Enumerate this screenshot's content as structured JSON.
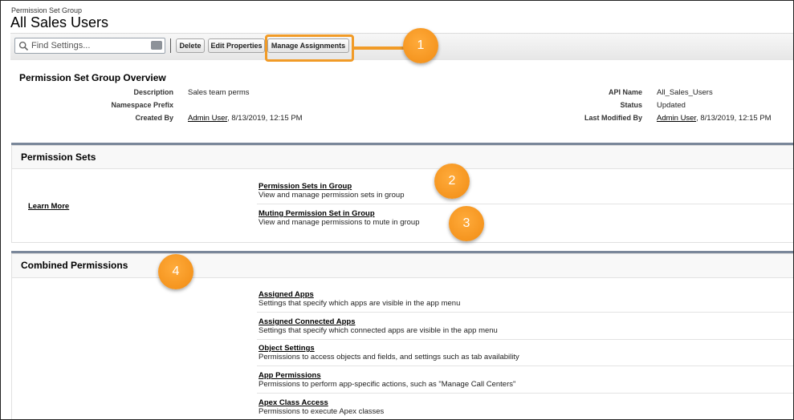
{
  "header": {
    "breadcrumb": "Permission Set Group",
    "title": "All Sales Users"
  },
  "toolbar": {
    "search_placeholder": "Find Settings...",
    "delete_label": "Delete",
    "edit_label": "Edit Properties",
    "manage_label": "Manage Assignments"
  },
  "overview": {
    "heading": "Permission Set Group Overview",
    "description_label": "Description",
    "description_value": "Sales team perms",
    "namespace_label": "Namespace Prefix",
    "created_label": "Created By",
    "created_user": "Admin User",
    "created_date": ", 8/13/2019, 12:15 PM",
    "api_label": "API Name",
    "api_value": "All_Sales_Users",
    "status_label": "Status",
    "status_value": "Updated",
    "modified_label": "Last Modified By",
    "modified_user": "Admin User",
    "modified_date": ", 8/13/2019, 12:15 PM"
  },
  "permission_sets": {
    "heading": "Permission Sets",
    "learn_more": "Learn More",
    "items": [
      {
        "title": "Permission Sets in Group",
        "desc": "View and manage permission sets in group"
      },
      {
        "title": "Muting Permission Set in Group",
        "desc": "View and manage permissions to mute in group"
      }
    ]
  },
  "combined": {
    "heading": "Combined Permissions",
    "items": [
      {
        "title": "Assigned Apps",
        "desc": "Settings that specify which apps are visible in the app menu"
      },
      {
        "title": "Assigned Connected Apps",
        "desc": "Settings that specify which connected apps are visible in the app menu"
      },
      {
        "title": "Object Settings",
        "desc": "Permissions to access objects and fields, and settings such as tab availability"
      },
      {
        "title": "App Permissions",
        "desc": "Permissions to perform app-specific actions, such as \"Manage Call Centers\""
      },
      {
        "title": "Apex Class Access",
        "desc": "Permissions to execute Apex classes"
      }
    ]
  },
  "callouts": [
    "1",
    "2",
    "3",
    "4"
  ],
  "colors": {
    "callout": "#f19b27",
    "panel_rule": "#7a879a"
  },
  "icons": [
    "search-icon",
    "keyboard-icon"
  ]
}
